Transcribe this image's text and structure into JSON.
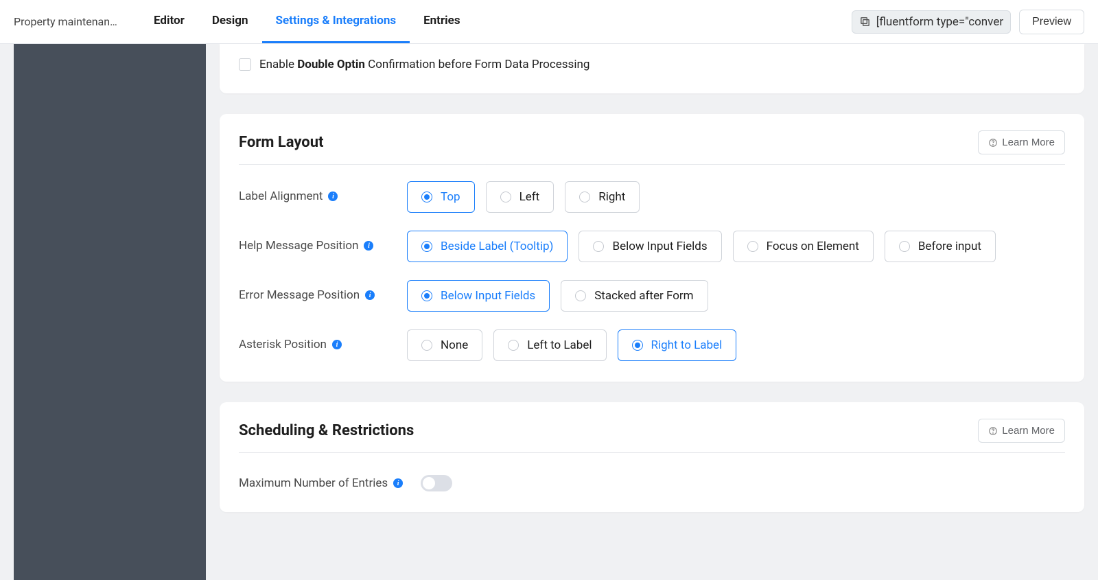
{
  "header": {
    "form_title": "Property maintenan…",
    "tabs": [
      "Editor",
      "Design",
      "Settings & Integrations",
      "Entries"
    ],
    "active_tab_index": 2,
    "shortcode": "[fluentform type=\"conver",
    "preview_label": "Preview"
  },
  "sections": {
    "optin": {
      "label_prefix": "Enable ",
      "label_bold": "Double Optin",
      "label_suffix": " Confirmation before Form Data Processing",
      "checked": false
    },
    "form_layout": {
      "title": "Form Layout",
      "learn_more": "Learn More",
      "rows": [
        {
          "label": "Label Alignment",
          "options": [
            "Top",
            "Left",
            "Right"
          ],
          "selected_index": 0
        },
        {
          "label": "Help Message Position",
          "options": [
            "Beside Label (Tooltip)",
            "Below Input Fields",
            "Focus on Element",
            "Before input"
          ],
          "selected_index": 0
        },
        {
          "label": "Error Message Position",
          "options": [
            "Below Input Fields",
            "Stacked after Form"
          ],
          "selected_index": 0
        },
        {
          "label": "Asterisk Position",
          "options": [
            "None",
            "Left to Label",
            "Right to Label"
          ],
          "selected_index": 2
        }
      ]
    },
    "scheduling": {
      "title": "Scheduling & Restrictions",
      "learn_more": "Learn More",
      "max_entries_label": "Maximum Number of Entries",
      "max_entries_enabled": false
    }
  }
}
